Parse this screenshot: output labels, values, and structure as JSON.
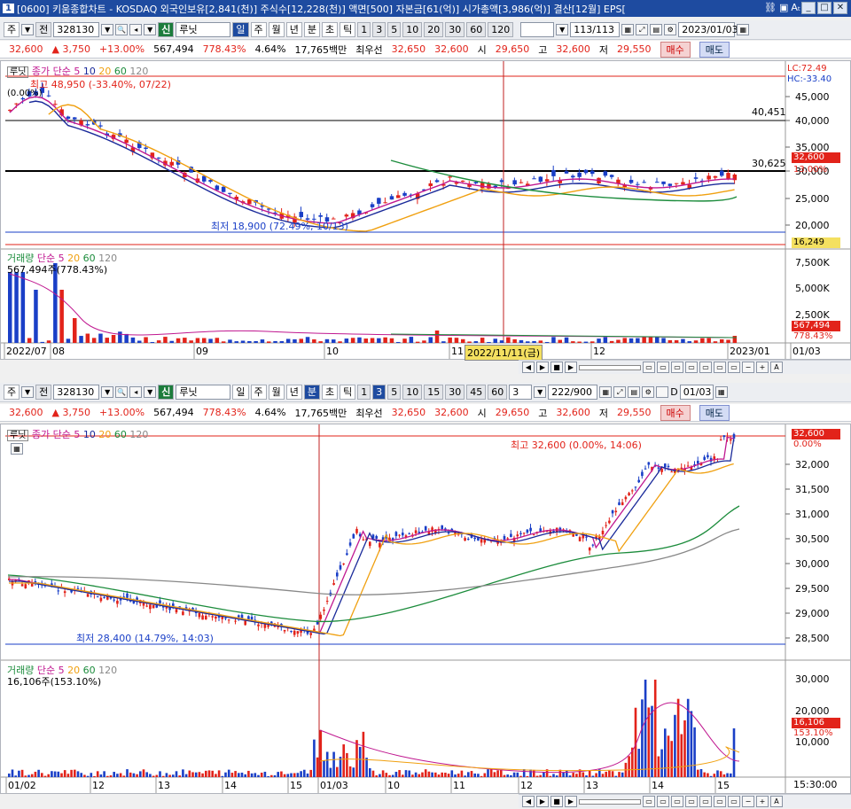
{
  "window": {
    "badge": "1",
    "title": "[0600] 키움종합차트 - KOSDAQ 외국인보유[2,841(천)] 주식수[12,228(천)] 액면[500] 자본금[61(억)] 시가총액[3,986(억)] 결산[12월] EPS["
  },
  "top": {
    "toolbar": {
      "mode": "주",
      "prev": "전",
      "code": "328130",
      "name": "루닛",
      "name_prefix": "신",
      "periods": [
        "일",
        "주",
        "월",
        "년",
        "분",
        "초",
        "틱"
      ],
      "active_period": "일",
      "intervals": [
        "1",
        "3",
        "5",
        "10",
        "20",
        "30",
        "60",
        "120"
      ],
      "count": "113/113",
      "date": "2023/01/03"
    },
    "quote": {
      "price": "32,600",
      "change": "▲ 3,750",
      "pct": "+13.00%",
      "volume": "567,494",
      "vol_pct": "778.43%",
      "turnover": "4.64%",
      "amount": "17,765백만",
      "best_label": "최우선",
      "ask": "32,650",
      "bid": "32,600",
      "open_label": "시",
      "open": "29,650",
      "high_label": "고",
      "high": "32,600",
      "low_label": "저",
      "low": "29,550",
      "buy": "매수",
      "sell": "매도"
    },
    "legend": {
      "name": "루닛",
      "ma_label": "종가 단순",
      "ma": [
        "5",
        "10",
        "20",
        "60",
        "120"
      ]
    },
    "ann": {
      "high": "최고 48,950 (-33.40%, 07/22)",
      "pct0": "(0.00%)",
      "low": "최저 18,900 (72.49%, 10/13)",
      "line1": "40,451",
      "line2": "30,625"
    },
    "yaxis": [
      "45,000",
      "40,000",
      "35,000",
      "30,000",
      "25,000",
      "20,000"
    ],
    "lc": "LC:72.49",
    "hc": "HC:-33.40",
    "price_box": "32,600",
    "price_pct": "13.00%",
    "low_box": "16,249",
    "vol_legend": {
      "name": "거래량",
      "ma_label": "단순",
      "ma": [
        "5",
        "20",
        "60",
        "120"
      ],
      "value": "567,494주(778.43%)"
    },
    "vol_axis": [
      "7,500K",
      "5,000K",
      "2,500K"
    ],
    "vol_box": "567,494",
    "vol_pct_box": "778.43%",
    "xaxis": [
      "2022/07",
      "08",
      "09",
      "10",
      "11",
      "12",
      "2023/01",
      "01/03"
    ],
    "crosshair_date": "2022/11/11(금)"
  },
  "bottom": {
    "toolbar": {
      "mode": "주",
      "prev": "전",
      "code": "328130",
      "name": "루닛",
      "name_prefix": "신",
      "periods": [
        "일",
        "주",
        "월",
        "년",
        "분",
        "초",
        "틱"
      ],
      "active_period": "분",
      "intervals": [
        "1",
        "3",
        "5",
        "10",
        "15",
        "30",
        "45",
        "60"
      ],
      "active_interval": "3",
      "tick": "3",
      "count": "222/900",
      "date_label": "D",
      "date": "01/03"
    },
    "quote": {
      "price": "32,600",
      "change": "▲ 3,750",
      "pct": "+13.00%",
      "volume": "567,494",
      "vol_pct": "778.43%",
      "turnover": "4.64%",
      "amount": "17,765백만",
      "best_label": "최우선",
      "ask": "32,650",
      "bid": "32,600",
      "open_label": "시",
      "open": "29,650",
      "high_label": "고",
      "high": "32,600",
      "low_label": "저",
      "low": "29,550",
      "buy": "매수",
      "sell": "매도"
    },
    "legend": {
      "name": "루닛",
      "ma_label": "종가 단순",
      "ma": [
        "5",
        "10",
        "20",
        "60",
        "120"
      ]
    },
    "ann": {
      "high": "최고 32,600 (0.00%, 14:06)",
      "low": "최저 28,400 (14.79%, 14:03)"
    },
    "yaxis": [
      "32,000",
      "31,500",
      "31,000",
      "30,500",
      "30,000",
      "29,500",
      "29,000",
      "28,500"
    ],
    "price_box": "32,600",
    "price_pct": "0.00%",
    "vol_legend": {
      "name": "거래량",
      "ma_label": "단순",
      "ma": [
        "5",
        "20",
        "60",
        "120"
      ],
      "value": "16,106주(153.10%)"
    },
    "vol_axis": [
      "30,000",
      "20,000",
      "10,000"
    ],
    "vol_box": "16,106",
    "vol_pct_box": "153.10%",
    "xaxis": [
      "01/02",
      "12",
      "13",
      "14",
      "15",
      "01/03",
      "10",
      "11",
      "12",
      "13",
      "14",
      "15"
    ],
    "time": "15:30:00"
  },
  "colors": {
    "up": "#e2231a",
    "down": "#1a3fc7",
    "ma5": "#c01890",
    "ma10": "#1a2a9a",
    "ma20": "#f0a010",
    "ma60": "#1c8c3c",
    "ma120": "#888888"
  }
}
